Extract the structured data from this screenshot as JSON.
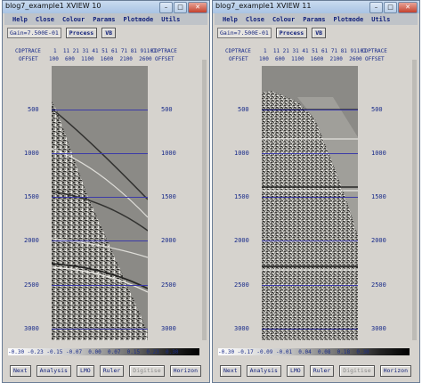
{
  "windows": [
    {
      "title": "blog7_example1 XVIEW 10",
      "menu": [
        "Help",
        "Close",
        "Colour",
        "Params",
        "Plotmode",
        "Utils"
      ],
      "gain": "Gain=7.500E-01",
      "process_label": "Process",
      "vb_label": "VB",
      "header1_left": "CDPTRACE",
      "header1_values": "1  11 21 31 41 51 61 71 81 91101",
      "header1_right": "CDPTRACE",
      "header2_left": "OFFSET",
      "header2_values": "100  600  1100  1600  2100  2600",
      "header2_right": "OFFSET",
      "time_labels": [
        "500",
        "1000",
        "1500",
        "2000",
        "2500",
        "3000"
      ],
      "colorbar_labels": "-0.30 -0.23 -0.15 -0.07  0.00  0.07  0.15  0.23  0.30",
      "buttons": [
        "Next",
        "Analysis",
        "LMO",
        "Ruler",
        "Digitise",
        "Horizon"
      ]
    },
    {
      "title": "blog7_example1 XVIEW 11",
      "menu": [
        "Help",
        "Close",
        "Colour",
        "Params",
        "Plotmode",
        "Utils"
      ],
      "gain": "Gain=7.500E-01",
      "process_label": "Process",
      "vb_label": "VB",
      "header1_left": "CDPTRACE",
      "header1_values": "1  11 21 31 41 51 61 71 81 91101",
      "header1_right": "CDPTRACE",
      "header2_left": "OFFSET",
      "header2_values": "100  600  1100  1600  2100  2600",
      "header2_right": "OFFSET",
      "time_labels": [
        "500",
        "1000",
        "1500",
        "2000",
        "2500",
        "3000"
      ],
      "colorbar_labels": "-0.30 -0.17 -0.09 -0.01  0.04  0.08  0.18  0.30",
      "buttons": [
        "Next",
        "Analysis",
        "LMO",
        "Ruler",
        "Digitise",
        "Horizon"
      ]
    }
  ],
  "window_controls": {
    "minimize": "–",
    "maximize": "□",
    "close": "✕"
  }
}
